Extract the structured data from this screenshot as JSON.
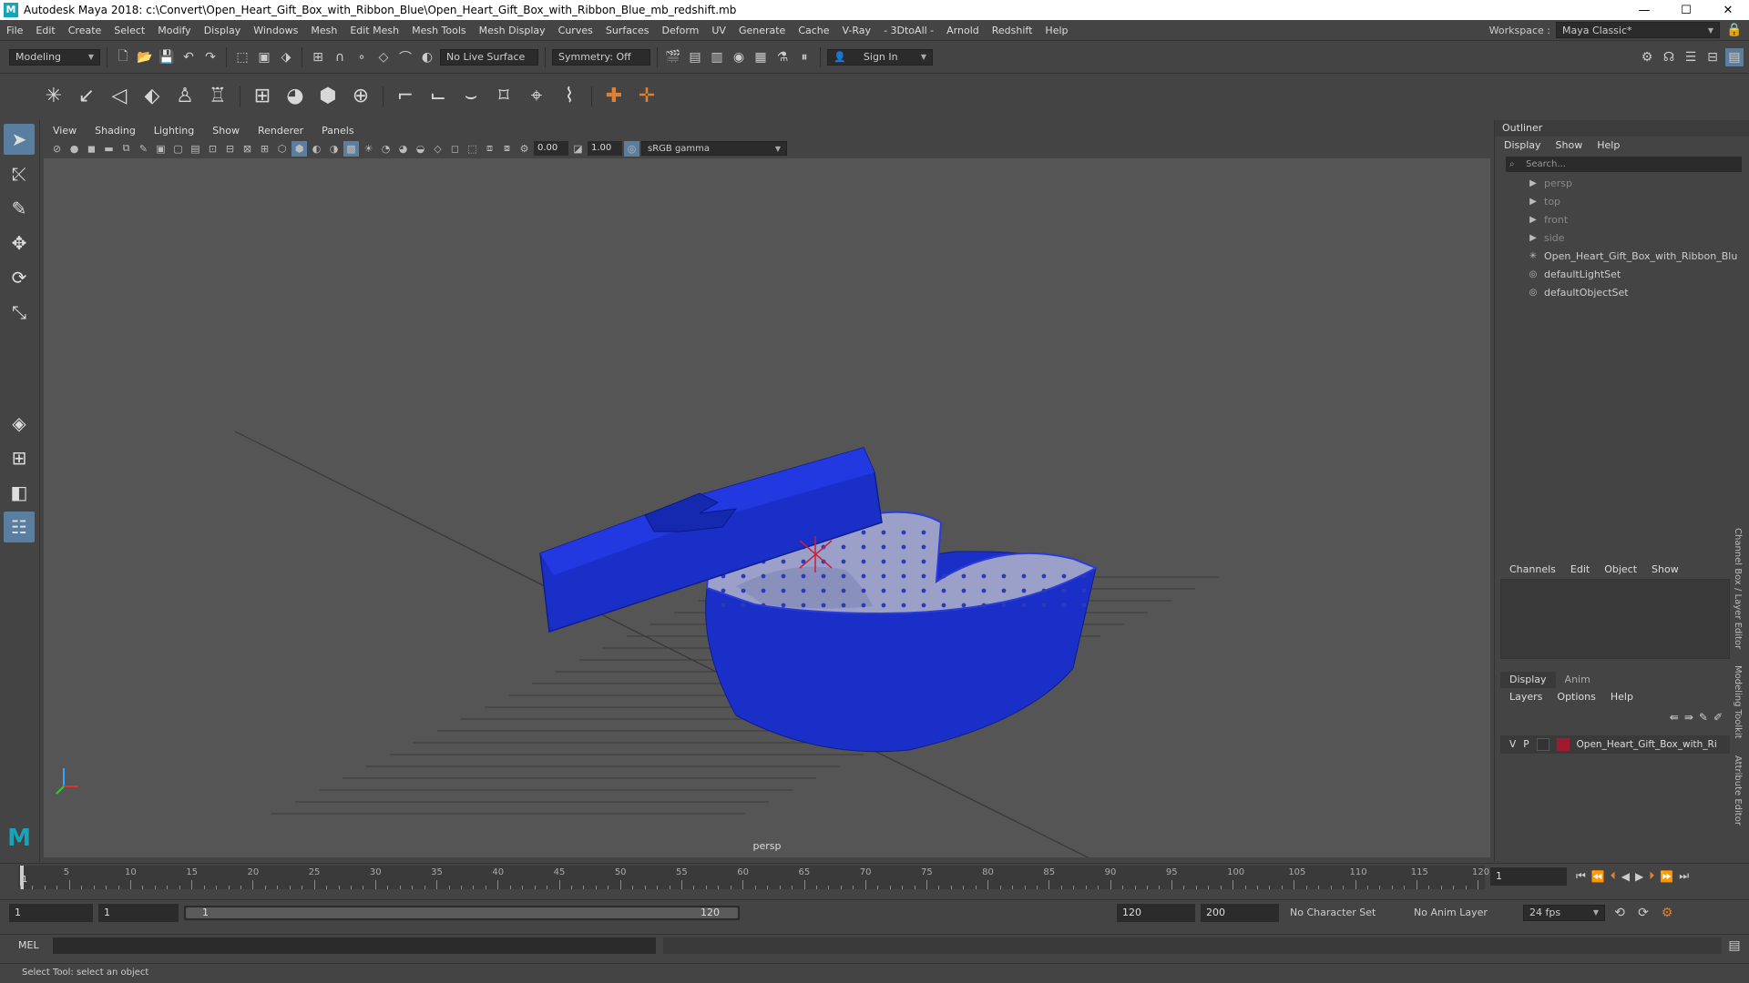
{
  "window": {
    "title": "Autodesk Maya 2018: c:\\Convert\\Open_Heart_Gift_Box_with_Ribbon_Blue\\Open_Heart_Gift_Box_with_Ribbon_Blue_mb_redshift.mb",
    "logo": "M",
    "minimize": "—",
    "maximize": "☐",
    "close": "✕"
  },
  "menubar": {
    "items": [
      "File",
      "Edit",
      "Create",
      "Select",
      "Modify",
      "Display",
      "Windows",
      "Mesh",
      "Edit Mesh",
      "Mesh Tools",
      "Mesh Display",
      "Curves",
      "Surfaces",
      "Deform",
      "UV",
      "Generate",
      "Cache",
      "V-Ray",
      "- 3DtoAll -",
      "Arnold",
      "Redshift",
      "Help"
    ],
    "workspace_label": "Workspace :",
    "workspace_value": "Maya Classic*"
  },
  "statusline": {
    "mode": "Modeling",
    "live_surface": "No Live Surface",
    "symmetry": "Symmetry: Off",
    "sign_in": "Sign In"
  },
  "viewport": {
    "menus": [
      "View",
      "Shading",
      "Lighting",
      "Show",
      "Renderer",
      "Panels"
    ],
    "exposure": "0.00",
    "gamma": "1.00",
    "color_space": "sRGB gamma",
    "camera_label": "persp",
    "box_color": "#1a2fc8",
    "interior_color": "#9aa0c8"
  },
  "outliner": {
    "title": "Outliner",
    "menus": [
      "Display",
      "Show",
      "Help"
    ],
    "search_placeholder": "Search...",
    "items": [
      {
        "label": "persp",
        "icon": "camera-icon",
        "dim": true
      },
      {
        "label": "top",
        "icon": "camera-icon",
        "dim": true
      },
      {
        "label": "front",
        "icon": "camera-icon",
        "dim": true
      },
      {
        "label": "side",
        "icon": "camera-icon",
        "dim": true
      },
      {
        "label": "Open_Heart_Gift_Box_with_Ribbon_Blu",
        "icon": "group-icon",
        "dim": false
      },
      {
        "label": "defaultLightSet",
        "icon": "set-icon",
        "dim": false
      },
      {
        "label": "defaultObjectSet",
        "icon": "set-icon",
        "dim": false
      }
    ]
  },
  "channelbox": {
    "menus": [
      "Channels",
      "Edit",
      "Object",
      "Show"
    ]
  },
  "layers": {
    "tabs": [
      "Display",
      "Anim"
    ],
    "menus": [
      "Layers",
      "Options",
      "Help"
    ],
    "row": {
      "v": "V",
      "p": "P",
      "name": "Open_Heart_Gift_Box_with_Ri",
      "color": "#a0192f"
    }
  },
  "sidetabs": [
    "Channel Box / Layer Editor",
    "Modeling Toolkit",
    "Attribute Editor"
  ],
  "timeline": {
    "labels": [
      "5",
      "10",
      "15",
      "20",
      "25",
      "30",
      "35",
      "40",
      "45",
      "50",
      "55",
      "60",
      "65",
      "70",
      "75",
      "80",
      "85",
      "90",
      "95",
      "100",
      "105",
      "110",
      "115",
      "120"
    ],
    "current_frame": "1",
    "frame_field": "1"
  },
  "range": {
    "start": "1",
    "start2": "1",
    "slider_start": "1",
    "slider_end": "120",
    "end": "120",
    "end2": "200",
    "character_set": "No Character Set",
    "anim_layer": "No Anim Layer",
    "fps": "24 fps"
  },
  "mel": {
    "label": "MEL"
  },
  "helpline": {
    "text": "Select Tool: select an object"
  }
}
